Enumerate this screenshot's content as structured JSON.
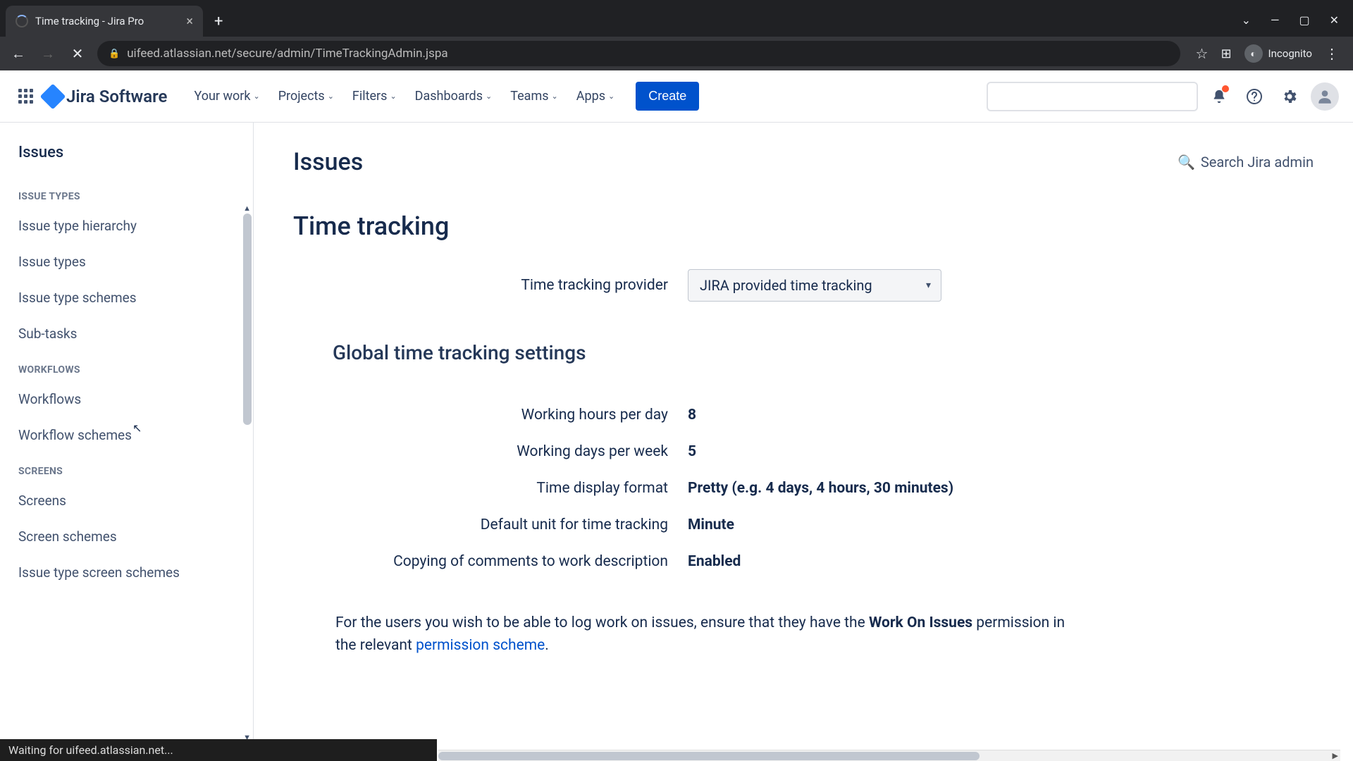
{
  "browser": {
    "tab_title": "Time tracking - Jira Pro",
    "url": "uifeed.atlassian.net/secure/admin/TimeTrackingAdmin.jspa",
    "incognito_label": "Incognito",
    "status": "Waiting for uifeed.atlassian.net..."
  },
  "header": {
    "product": "Jira Software",
    "nav": [
      "Your work",
      "Projects",
      "Filters",
      "Dashboards",
      "Teams",
      "Apps"
    ],
    "create": "Create"
  },
  "sidebar": {
    "title": "Issues",
    "sections": [
      {
        "label": "ISSUE TYPES",
        "items": [
          "Issue type hierarchy",
          "Issue types",
          "Issue type schemes",
          "Sub-tasks"
        ]
      },
      {
        "label": "WORKFLOWS",
        "items": [
          "Workflows",
          "Workflow schemes"
        ]
      },
      {
        "label": "SCREENS",
        "items": [
          "Screens",
          "Screen schemes",
          "Issue type screen schemes"
        ]
      }
    ]
  },
  "main": {
    "page_title": "Issues",
    "admin_search": "Search Jira admin",
    "section_title": "Time tracking",
    "provider_label": "Time tracking provider",
    "provider_value": "JIRA provided time tracking",
    "global_title": "Global time tracking settings",
    "settings": [
      {
        "label": "Working hours per day",
        "value": "8",
        "bold": true
      },
      {
        "label": "Working days per week",
        "value": "5",
        "bold": true
      },
      {
        "label": "Time display format",
        "value": "Pretty (e.g. 4 days, 4 hours, 30 minutes)",
        "bold": true
      },
      {
        "label": "Default unit for time tracking",
        "value": "Minute",
        "bold": true
      },
      {
        "label": "Copying of comments to work description",
        "value": "Enabled",
        "bold": true
      }
    ],
    "note_pre": "For the users you wish to be able to log work on issues, ensure that they have the ",
    "note_bold": "Work On Issues",
    "note_mid": " permission in the relevant ",
    "note_link": "permission scheme",
    "note_post": "."
  }
}
